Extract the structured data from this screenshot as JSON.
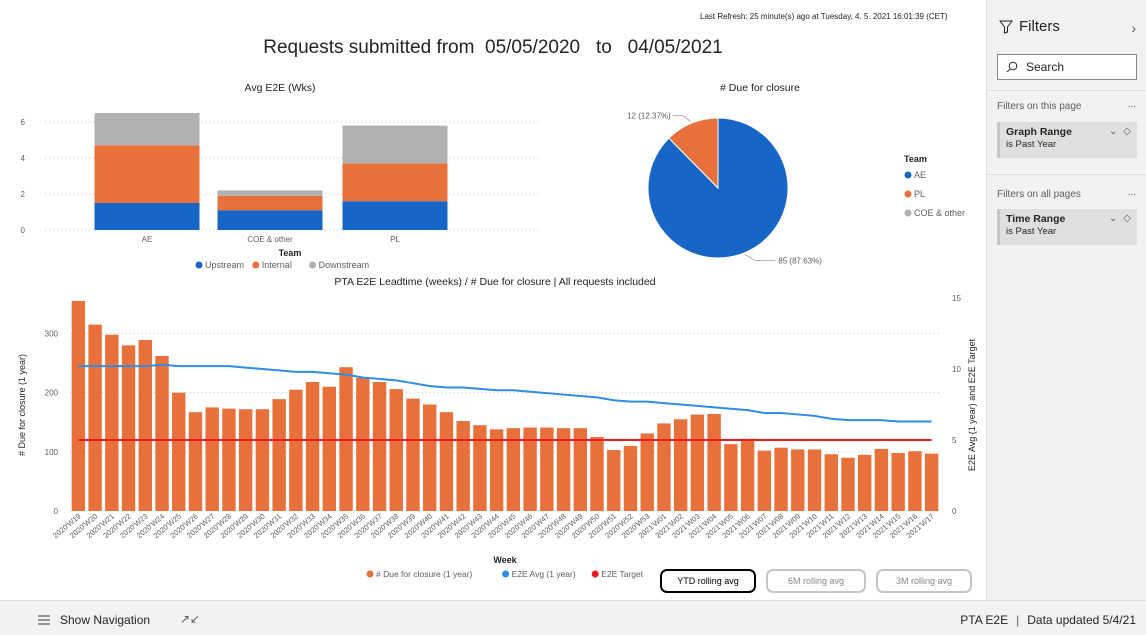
{
  "last_refresh": "Last Refresh: 25 minute(s) ago at Tuesday, 4. 5. 2021 16:01:39 (CET)",
  "title": {
    "prefix": "Requests submitted from",
    "from": "05/05/2020",
    "to_word": "to",
    "to": "04/05/2021"
  },
  "filters": {
    "header": "Filters",
    "search_placeholder": "Search",
    "this_page_label": "Filters on this page",
    "this_page": [
      {
        "name": "Graph Range",
        "value": "is Past Year"
      }
    ],
    "all_pages_label": "Filters on all pages",
    "all_pages": [
      {
        "name": "Time Range",
        "value": "is Past Year"
      }
    ],
    "more": "..."
  },
  "buttons": {
    "ytd": "YTD rolling avg",
    "six_m": "6M rolling avg",
    "three_m": "3M rolling avg"
  },
  "bottombar": {
    "show_navigation": "Show Navigation",
    "report_name": "PTA E2E",
    "data_updated": "Data updated 5/4/21"
  },
  "colors": {
    "upstream": "#1765c4",
    "internal": "#e8703a",
    "downstream": "#b1b1b1",
    "avg_line": "#2f8de4",
    "target_line": "#ee1c1c"
  },
  "chart_data": [
    {
      "type": "bar",
      "stacked": true,
      "title": "Avg E2E (Wks)",
      "xlabel": "Team",
      "categories": [
        "AE",
        "COE & other",
        "PL"
      ],
      "series": [
        {
          "name": "Upstream",
          "values": [
            1.5,
            1.1,
            1.6
          ]
        },
        {
          "name": "Internal",
          "values": [
            3.2,
            0.8,
            2.1
          ]
        },
        {
          "name": "Downstream",
          "values": [
            1.8,
            0.3,
            2.1
          ]
        }
      ],
      "ylim": [
        0,
        7
      ],
      "yticks": [
        0,
        2,
        4,
        6
      ],
      "legend_position": "bottom",
      "grid": true
    },
    {
      "type": "pie",
      "title": "# Due for closure",
      "legend_title": "Team",
      "legend_entries": [
        "AE",
        "PL",
        "COE & other"
      ],
      "slices": [
        {
          "name": "AE",
          "value": 85,
          "label": "85 (87.63%)"
        },
        {
          "name": "PL",
          "value": 12,
          "label": "12 (12.37%)"
        }
      ],
      "legend_position": "right"
    },
    {
      "type": "bar",
      "combo": true,
      "title": "PTA E2E Leadtime (weeks) / # Due for closure | All requests included",
      "xlabel": "Week",
      "ylabel": "# Due for closure (1 year)",
      "y2label": "E2E Avg (1 year) and E2E Target",
      "ylim": [
        0,
        360
      ],
      "yticks": [
        0,
        100,
        200,
        300
      ],
      "y2lim": [
        0,
        15
      ],
      "y2ticks": [
        0,
        5,
        10,
        15
      ],
      "grid": true,
      "legend_position": "bottom",
      "categories": [
        "2020'W19",
        "2020'W20",
        "2020'W21",
        "2020'W22",
        "2020'W23",
        "2020'W24",
        "2020'W25",
        "2020'W26",
        "2020'W27",
        "2020'W28",
        "2020'W29",
        "2020'W30",
        "2020'W31",
        "2020'W32",
        "2020'W33",
        "2020'W34",
        "2020'W35",
        "2020'W36",
        "2020'W37",
        "2020'W38",
        "2020'W39",
        "2020'W40",
        "2020'W41",
        "2020'W42",
        "2020'W43",
        "2020'W44",
        "2020'W45",
        "2020'W46",
        "2020'W47",
        "2020'W48",
        "2020'W49",
        "2020'W50",
        "2020'W51",
        "2020'W52",
        "2020'W53",
        "2021'W01",
        "2021'W02",
        "2021'W03",
        "2021'W04",
        "2021'W05",
        "2021'W06",
        "2021'W07",
        "2021'W08",
        "2021'W09",
        "2021'W10",
        "2021'W11",
        "2021'W12",
        "2021'W13",
        "2021'W14",
        "2021'W15",
        "2021'W16",
        "2021'W17"
      ],
      "series": [
        {
          "name": "# Due for closure (1 year)",
          "kind": "bar",
          "axis": "y",
          "values": [
            355,
            315,
            298,
            280,
            289,
            262,
            200,
            167,
            175,
            173,
            172,
            172,
            189,
            205,
            218,
            210,
            243,
            225,
            218,
            206,
            190,
            180,
            167,
            152,
            145,
            138,
            140,
            141,
            141,
            140,
            140,
            125,
            103,
            110,
            131,
            148,
            155,
            163,
            164,
            113,
            122,
            102,
            107,
            104,
            104,
            96,
            90,
            95,
            105,
            98,
            101,
            97,
            101
          ]
        },
        {
          "name": "E2E Avg (1 year)",
          "kind": "line",
          "axis": "y2",
          "values": [
            10.2,
            10.2,
            10.2,
            10.2,
            10.2,
            10.3,
            10.2,
            10.2,
            10.2,
            10.2,
            10.1,
            10.0,
            9.9,
            9.8,
            9.8,
            9.7,
            9.6,
            9.4,
            9.3,
            9.2,
            9.0,
            8.8,
            8.7,
            8.7,
            8.6,
            8.5,
            8.5,
            8.4,
            8.3,
            8.2,
            8.1,
            8.0,
            7.8,
            7.7,
            7.7,
            7.6,
            7.5,
            7.4,
            7.3,
            7.2,
            7.1,
            6.9,
            6.9,
            6.8,
            6.7,
            6.5,
            6.4,
            6.4,
            6.4,
            6.3,
            6.3,
            6.3,
            6.2
          ]
        },
        {
          "name": "E2E Target",
          "kind": "line",
          "axis": "y2",
          "values": [
            5,
            5,
            5,
            5,
            5,
            5,
            5,
            5,
            5,
            5,
            5,
            5,
            5,
            5,
            5,
            5,
            5,
            5,
            5,
            5,
            5,
            5,
            5,
            5,
            5,
            5,
            5,
            5,
            5,
            5,
            5,
            5,
            5,
            5,
            5,
            5,
            5,
            5,
            5,
            5,
            5,
            5,
            5,
            5,
            5,
            5,
            5,
            5,
            5,
            5,
            5,
            5,
            5
          ]
        }
      ]
    }
  ]
}
